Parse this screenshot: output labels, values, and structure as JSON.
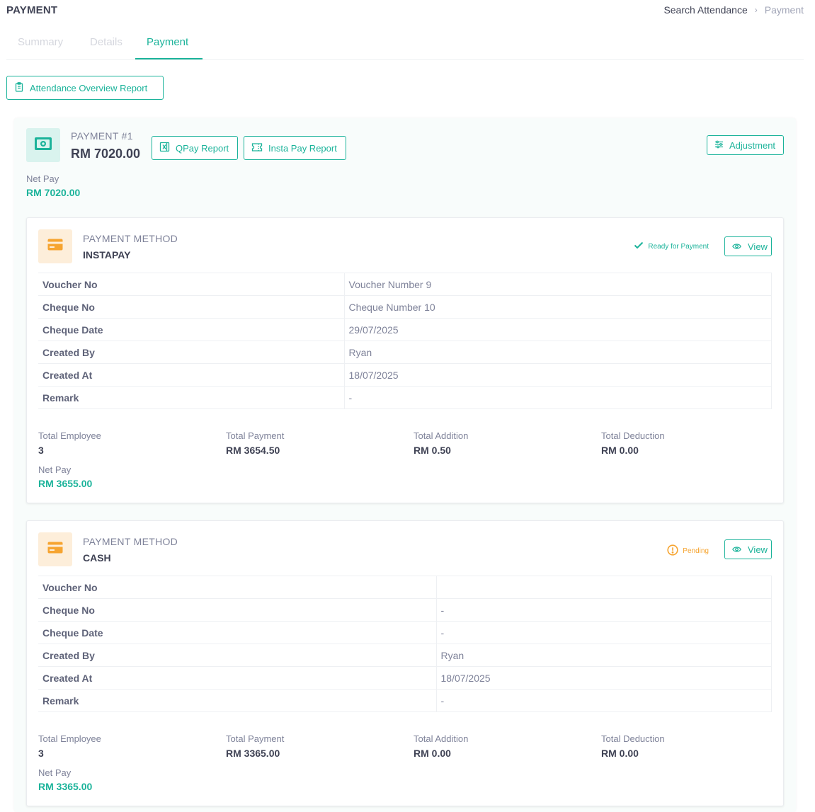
{
  "header": {
    "title": "PAYMENT",
    "breadcrumb": {
      "link": "Search Attendance",
      "separator": "›",
      "current": "Payment"
    }
  },
  "tabs": [
    {
      "label": "Summary",
      "active": false
    },
    {
      "label": "Details",
      "active": false
    },
    {
      "label": "Payment",
      "active": true
    }
  ],
  "toolbar": {
    "report_button": "Attendance Overview Report"
  },
  "payment": {
    "heading": "PAYMENT #1",
    "amount": "RM 7020.00",
    "qpay_button": "QPay Report",
    "instapay_button": "Insta Pay Report",
    "adjustment_button": "Adjustment",
    "net_pay_label": "Net Pay",
    "net_pay_value": "RM 7020.00"
  },
  "methods": [
    {
      "label": "PAYMENT METHOD",
      "name": "INSTAPAY",
      "status": "Ready for Payment",
      "view_button": "View",
      "rows": [
        {
          "key": "Voucher No",
          "value": "Voucher Number 9"
        },
        {
          "key": "Cheque No",
          "value": "Cheque Number 10"
        },
        {
          "key": "Cheque Date",
          "value": "29/07/2025"
        },
        {
          "key": "Created By",
          "value": "Ryan"
        },
        {
          "key": "Created At",
          "value": "18/07/2025"
        },
        {
          "key": "Remark",
          "value": "-"
        }
      ],
      "stats": {
        "total_employee_label": "Total Employee",
        "total_employee": "3",
        "total_payment_label": "Total Payment",
        "total_payment": "RM 3654.50",
        "total_addition_label": "Total Addition",
        "total_addition": "RM 0.50",
        "total_deduction_label": "Total Deduction",
        "total_deduction": "RM 0.00",
        "net_pay_label": "Net Pay",
        "net_pay": "RM 3655.00"
      }
    },
    {
      "label": "PAYMENT METHOD",
      "name": "CASH",
      "status": "Pending",
      "view_button": "View",
      "rows": [
        {
          "key": "Voucher No",
          "value": ""
        },
        {
          "key": "Cheque No",
          "value": "-"
        },
        {
          "key": "Cheque Date",
          "value": "-"
        },
        {
          "key": "Created By",
          "value": "Ryan"
        },
        {
          "key": "Created At",
          "value": "18/07/2025"
        },
        {
          "key": "Remark",
          "value": "-"
        }
      ],
      "stats": {
        "total_employee_label": "Total Employee",
        "total_employee": "3",
        "total_payment_label": "Total Payment",
        "total_payment": "RM 3365.00",
        "total_addition_label": "Total Addition",
        "total_addition": "RM 0.00",
        "total_deduction_label": "Total Deduction",
        "total_deduction": "RM 0.00",
        "net_pay_label": "Net Pay",
        "net_pay": "RM 3365.00"
      }
    }
  ],
  "colors": {
    "accent": "#1bb39a",
    "warning": "#f6a430",
    "text": "#3f4254",
    "muted": "#7e8299"
  },
  "icons": [
    "cash-icon",
    "excel-icon",
    "ticket-icon",
    "sliders-icon",
    "clipboard-icon",
    "card-icon",
    "check-icon",
    "alert-icon",
    "eye-icon"
  ]
}
